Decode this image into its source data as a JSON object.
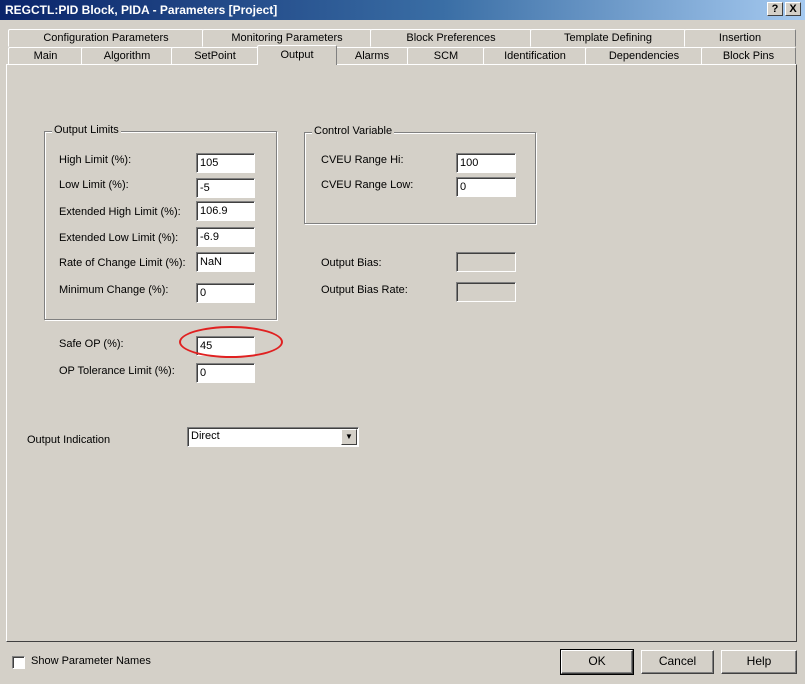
{
  "window": {
    "title": "REGCTL:PID Block, PIDA - Parameters [Project]",
    "help_btn": "?",
    "close_btn": "X"
  },
  "tabs_back": [
    "Configuration Parameters",
    "Monitoring Parameters",
    "Block Preferences",
    "Template Defining",
    "Insertion"
  ],
  "tabs_front": [
    "Main",
    "Algorithm",
    "SetPoint",
    "Output",
    "Alarms",
    "SCM",
    "Identification",
    "Dependencies",
    "Block Pins"
  ],
  "active_tab": "Output",
  "output_limits": {
    "title": "Output Limits",
    "fields": [
      {
        "label": "High Limit (%):",
        "value": "105"
      },
      {
        "label": "Low Limit (%):",
        "value": "-5"
      },
      {
        "label": "Extended High Limit (%):",
        "value": "106.9"
      },
      {
        "label": "Extended Low Limit (%):",
        "value": "-6.9"
      },
      {
        "label": "Rate of Change Limit (%):",
        "value": "NaN"
      },
      {
        "label": "Minimum Change (%):",
        "value": "0"
      }
    ]
  },
  "control_variable": {
    "title": "Control Variable",
    "fields": [
      {
        "label": "CVEU Range Hi:",
        "value": "100"
      },
      {
        "label": "CVEU Range Low:",
        "value": "0"
      }
    ]
  },
  "output_bias": {
    "label": "Output Bias:",
    "value": ""
  },
  "output_bias_rate": {
    "label": "Output Bias Rate:",
    "value": ""
  },
  "safe_op": {
    "label": "Safe OP (%):",
    "value": "45"
  },
  "op_tolerance": {
    "label": "OP Tolerance Limit (%):",
    "value": "0"
  },
  "output_indication": {
    "label": "Output Indication",
    "value": "Direct"
  },
  "footer": {
    "show_names": "Show Parameter Names",
    "ok": "OK",
    "cancel": "Cancel",
    "help": "Help"
  },
  "colors": {
    "highlight": "#e02020",
    "title_start": "#0a246a",
    "title_end": "#a6caf0"
  }
}
